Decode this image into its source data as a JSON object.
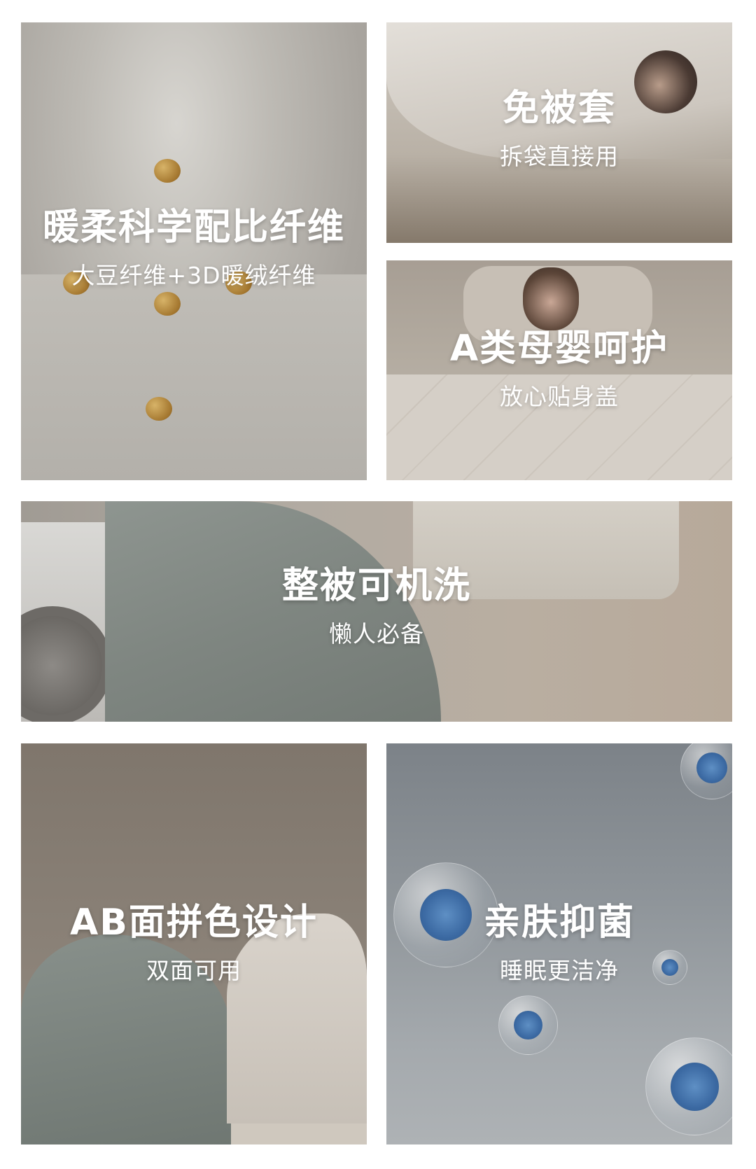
{
  "tiles": [
    {
      "title": "暖柔科学配比纤维",
      "subtitle": "大豆纤维+3D暖绒纤维"
    },
    {
      "title": "免被套",
      "subtitle": "拆袋直接用"
    },
    {
      "title": "A类母婴呵护",
      "subtitle": "放心贴身盖"
    },
    {
      "title": "整被可机洗",
      "subtitle": "懒人必备"
    },
    {
      "title": "AB面拼色设计",
      "subtitle": "双面可用"
    },
    {
      "title": "亲肤抑菌",
      "subtitle": "睡眠更洁净"
    }
  ],
  "colors": {
    "caption_text": "#ffffff",
    "background": "#ffffff",
    "germ_blue": "#3c6aa3",
    "soybean": "#b5893a"
  }
}
